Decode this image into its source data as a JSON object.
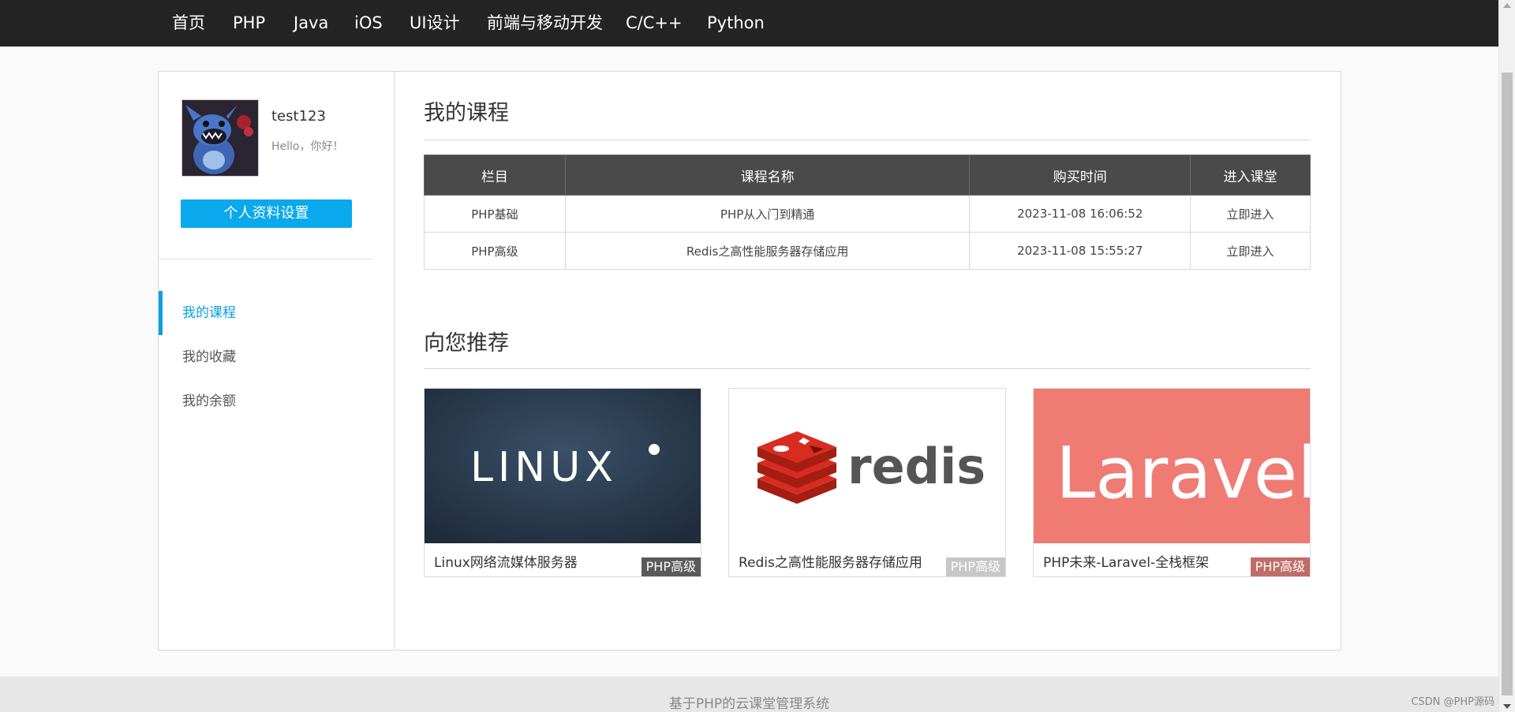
{
  "nav": {
    "items": [
      "首页",
      "PHP",
      "Java",
      "iOS",
      "UI设计",
      "前端与移动开发",
      "C/C++",
      "Python"
    ]
  },
  "user": {
    "name": "test123",
    "greeting": "Hello，你好！",
    "settings_button": "个人资料设置"
  },
  "sidebar": {
    "items": [
      {
        "label": "我的课程",
        "active": true
      },
      {
        "label": "我的收藏",
        "active": false
      },
      {
        "label": "我的余额",
        "active": false
      }
    ]
  },
  "courses": {
    "title": "我的课程",
    "headers": [
      "栏目",
      "课程名称",
      "购买时间",
      "进入课堂"
    ],
    "rows": [
      {
        "category": "PHP基础",
        "name": "PHP从入门到精通",
        "time": "2023-11-08 16:06:52",
        "action": "立即进入"
      },
      {
        "category": "PHP高级",
        "name": "Redis之高性能服务器存储应用",
        "time": "2023-11-08 15:55:27",
        "action": "立即进入"
      }
    ]
  },
  "recommend": {
    "title": "向您推荐",
    "cards": [
      {
        "title": "Linux网络流媒体服务器",
        "badge": "PHP高级",
        "logo_text": "LINUX",
        "bg": "#2b3c52"
      },
      {
        "title": "Redis之高性能服务器存储应用",
        "badge": "PHP高级",
        "logo_text": "redis",
        "bg": "#ffffff"
      },
      {
        "title": "PHP未来-Laravel-全栈框架",
        "badge": "PHP高级",
        "logo_text": "Laravel",
        "bg": "#ef7b72"
      }
    ]
  },
  "footer": {
    "text": "基于PHP的云课堂管理系统",
    "watermark": "CSDN @PHP源码"
  },
  "colors": {
    "nav_bg": "#242424",
    "accent": "#0aa8ec",
    "link": "#e8622c",
    "table_header": "#4a4a4a"
  }
}
